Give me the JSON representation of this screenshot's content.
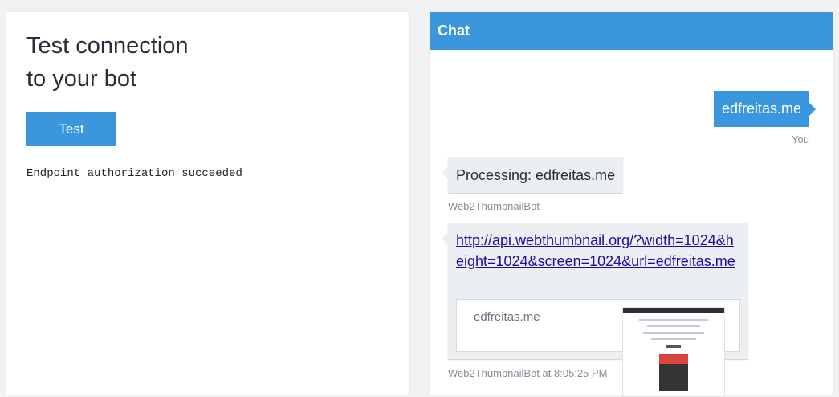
{
  "left_panel": {
    "title_line1": "Test connection",
    "title_line2": "to your bot",
    "test_button_label": "Test",
    "status_text": "Endpoint authorization succeeded"
  },
  "chat": {
    "header_title": "Chat",
    "messages": [
      {
        "from": "user",
        "text": "edfreitas.me",
        "label": "You"
      },
      {
        "from": "bot",
        "text": "Processing: edfreitas.me",
        "label": "Web2ThumbnailBot"
      },
      {
        "from": "bot",
        "text": "http://api.webthumbnail.org/?width=1024&height=1024&screen=1024&url=edfreitas.me",
        "card_title": "edfreitas.me",
        "label": "Web2ThumbnailBot at 8:05:25 PM"
      }
    ]
  },
  "colors": {
    "accent": "#3a96dd",
    "bot_bubble": "#eceff1",
    "link": "#1a0dab"
  }
}
